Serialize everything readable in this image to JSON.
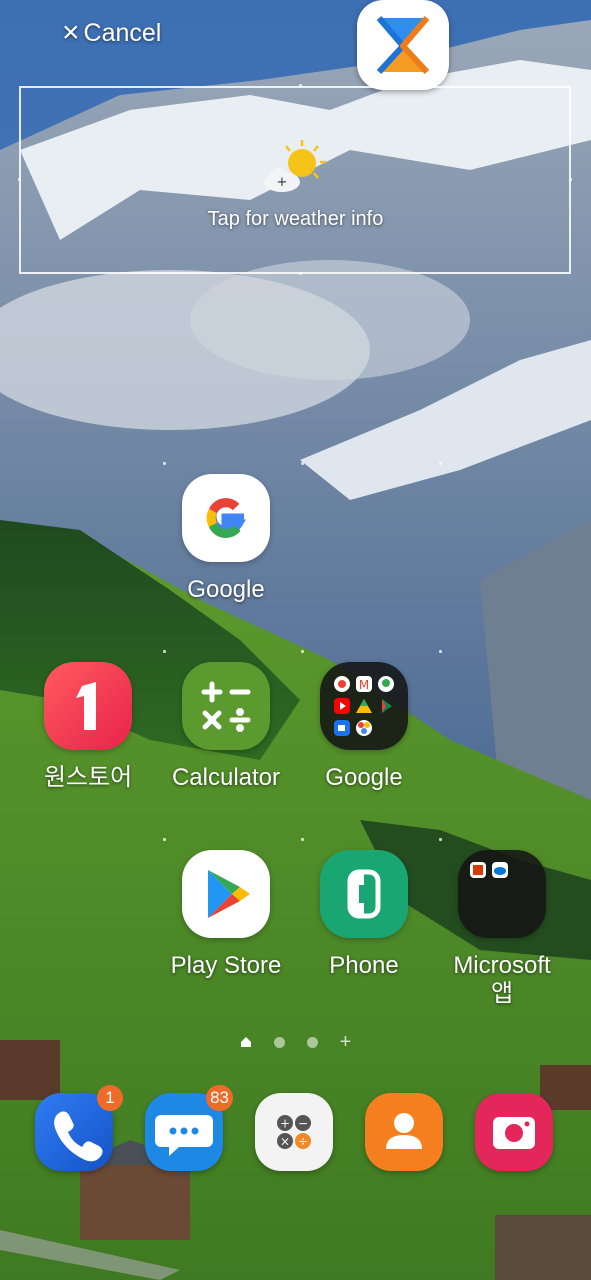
{
  "header": {
    "cancel_label": "Cancel"
  },
  "weather": {
    "text": "Tap for weather info"
  },
  "apps": {
    "google_single": {
      "label": "Google"
    },
    "onestore": {
      "label": "원스토어"
    },
    "calculator": {
      "label": "Calculator"
    },
    "google_folder": {
      "label": "Google"
    },
    "play_store": {
      "label": "Play Store"
    },
    "phone": {
      "label": "Phone"
    },
    "microsoft_line1": {
      "label": "Microsoft"
    },
    "microsoft_line2": {
      "label": "앱"
    }
  },
  "pager": {
    "pages": 3,
    "current_page": 1
  },
  "dock": {
    "phone_badge": "1",
    "messages_badge": "83"
  },
  "colors": {
    "badge": "#ef6b2a",
    "calculator_bg": "#5a9a2e",
    "phone_green": "#1aa673",
    "contacts_orange": "#f57f1f",
    "camera_red": "#e3275a",
    "messages_blue": "#1e88e5"
  }
}
